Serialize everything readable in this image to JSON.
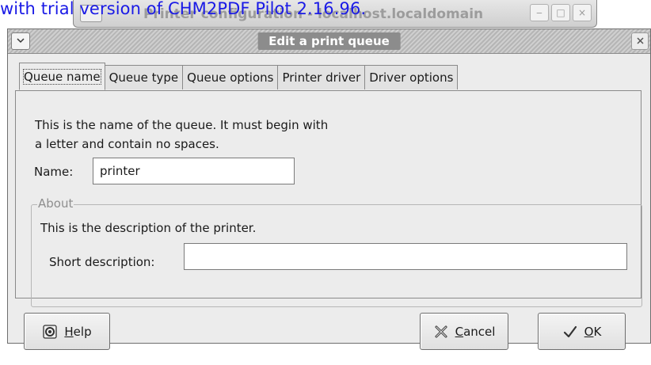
{
  "watermark": "with trial version of CHM2PDF Pilot 2.16.96.",
  "background_window": {
    "title": "Printer configuration - localhost.localdomain",
    "controls": [
      "‒",
      "□",
      "×"
    ]
  },
  "dialog": {
    "title": "Edit a print queue",
    "menu_icon": "chevron-down-icon",
    "close_icon": "close-icon",
    "tabs": [
      {
        "label": "Queue name",
        "active": true
      },
      {
        "label": "Queue type",
        "active": false
      },
      {
        "label": "Queue options",
        "active": false
      },
      {
        "label": "Printer driver",
        "active": false
      },
      {
        "label": "Driver options",
        "active": false
      }
    ],
    "queue_name": {
      "description_line1": "This is the name of the queue.  It must begin with",
      "description_line2": "a letter and contain no spaces.",
      "name_label": "Name:",
      "name_value": "printer"
    },
    "about": {
      "legend": "About",
      "description": "This is the description of the printer.",
      "short_description_label": "Short description:",
      "short_description_value": ""
    },
    "buttons": {
      "help": {
        "label_mnemonic": "H",
        "label_rest": "elp",
        "icon": "help-icon"
      },
      "cancel": {
        "label_mnemonic": "C",
        "label_rest": "ancel",
        "icon": "cancel-icon"
      },
      "ok": {
        "label_mnemonic": "O",
        "label_rest": "K",
        "icon": "checkmark-icon"
      }
    }
  }
}
